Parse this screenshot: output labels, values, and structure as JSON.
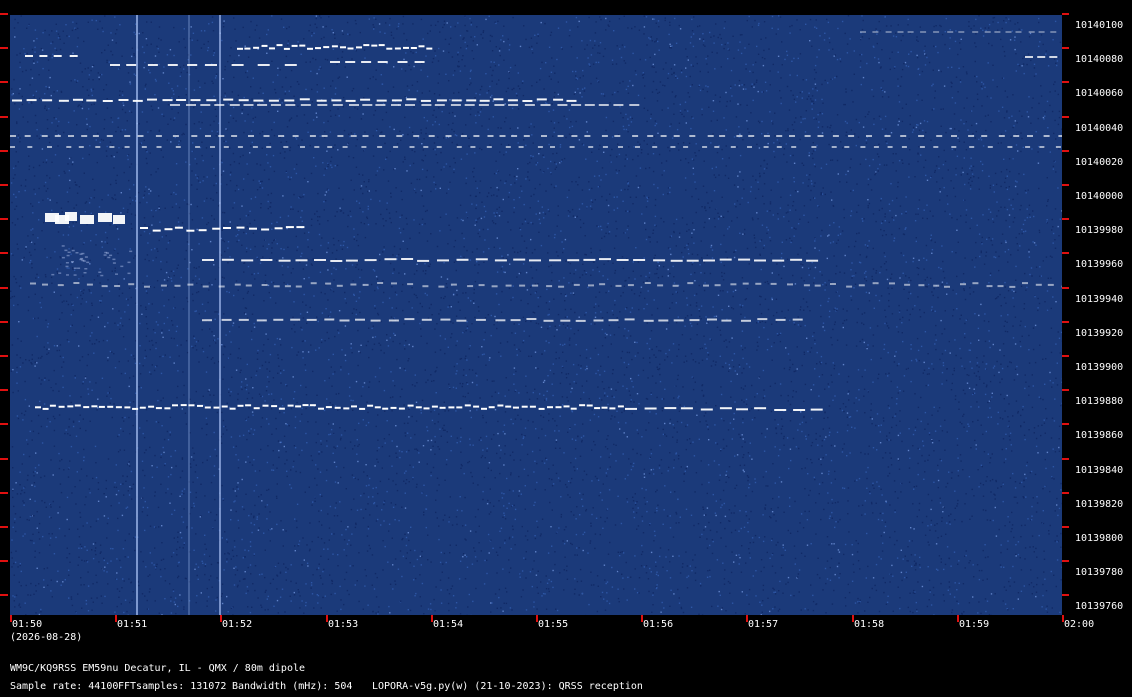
{
  "colors": {
    "background": "#000000",
    "spectrum": "#1b3a7a",
    "tick": "#e01010",
    "signal": "#ffffff"
  },
  "y_labels": [
    "10140100",
    "10140080",
    "10140060",
    "10140040",
    "10140020",
    "10140000",
    "10139980",
    "10139960",
    "10139940",
    "10139920",
    "10139900",
    "10139880",
    "10139860",
    "10139840",
    "10139820",
    "10139800",
    "10139780",
    "10139760"
  ],
  "x_labels": [
    "01:50",
    "01:51",
    "01:52",
    "01:53",
    "01:54",
    "01:55",
    "01:56",
    "01:57",
    "01:58",
    "01:59",
    "02:00"
  ],
  "date": "(2026-08-28)",
  "station": "WM9C/KQ9RSS EM59nu Decatur, IL - QMX / 80m dipole",
  "sample_rate": "Sample rate: 44100",
  "fft_samples": "FFTsamples: 131072",
  "bandwidth": "Bandwidth (mHz): 504",
  "software": "LOPORA-v5g.py(w) (21-10-2023): QRSS reception"
}
